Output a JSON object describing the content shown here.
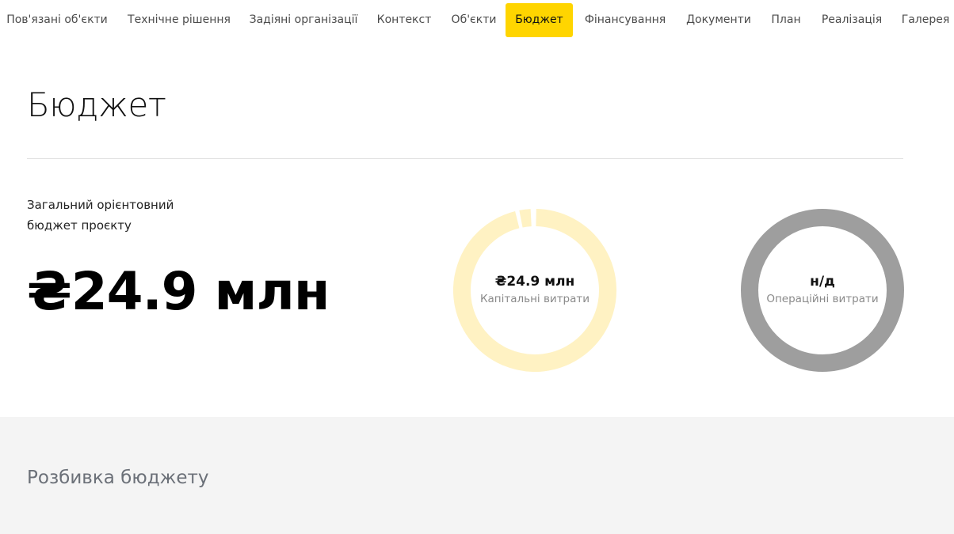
{
  "nav": {
    "items": [
      {
        "label": "Пов'язані об'єкти",
        "active": false
      },
      {
        "label": "Технічне рішення",
        "active": false
      },
      {
        "label": "Задіяні організації",
        "active": false
      },
      {
        "label": "Контекст",
        "active": false
      },
      {
        "label": "Об'єкти",
        "active": false
      },
      {
        "label": "Бюджет",
        "active": true
      },
      {
        "label": "Фінансування",
        "active": false
      },
      {
        "label": "Документи",
        "active": false
      },
      {
        "label": "План",
        "active": false
      },
      {
        "label": "Реалізація",
        "active": false
      },
      {
        "label": "Галерея",
        "active": false
      }
    ],
    "active_color": "#ffd500"
  },
  "page": {
    "title": "Бюджет"
  },
  "total": {
    "label_line1": "Загальний орієнтовний",
    "label_line2": "бюджет проєкту",
    "value": "₴24.9 млн"
  },
  "donuts": {
    "capex": {
      "value": "₴24.9 млн",
      "label": "Капітальні витрати",
      "color": "#fff2c3"
    },
    "opex": {
      "value": "н/д",
      "label": "Операційні витрати",
      "color": "#9e9e9e"
    }
  },
  "breakdown": {
    "title": "Розбивка бюджету"
  }
}
